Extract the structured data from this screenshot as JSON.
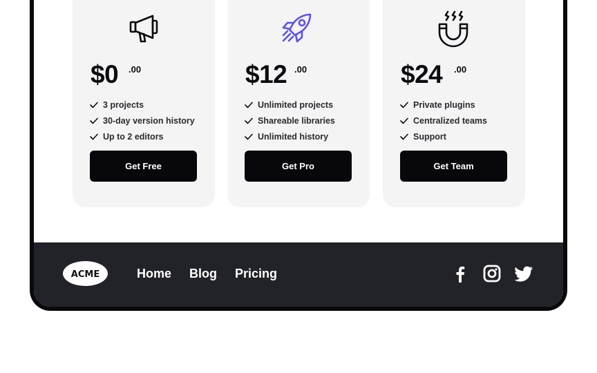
{
  "plans": [
    {
      "icon": "megaphone-icon",
      "price": "$0",
      "cents": ".00",
      "features": [
        "3 projects",
        "30-day version history",
        "Up to 2 editors"
      ],
      "cta": "Get Free"
    },
    {
      "icon": "rocket-icon",
      "price": "$12",
      "cents": ".00",
      "features": [
        "Unlimited projects",
        "Shareable libraries",
        "Unlimited history"
      ],
      "cta": "Get Pro"
    },
    {
      "icon": "magnet-icon",
      "price": "$24",
      "cents": ".00",
      "features": [
        "Private plugins",
        "Centralized teams",
        "Support"
      ],
      "cta": "Get Team"
    }
  ],
  "footer": {
    "logo_text": "ACME",
    "nav": [
      "Home",
      "Blog",
      "Pricing"
    ],
    "social": [
      "facebook-icon",
      "instagram-icon",
      "twitter-icon"
    ]
  },
  "colors": {
    "accent": "#5b4ff1",
    "button": "#07070c",
    "footer_bg": "#222329",
    "card_bg": "#f4f4f4"
  }
}
